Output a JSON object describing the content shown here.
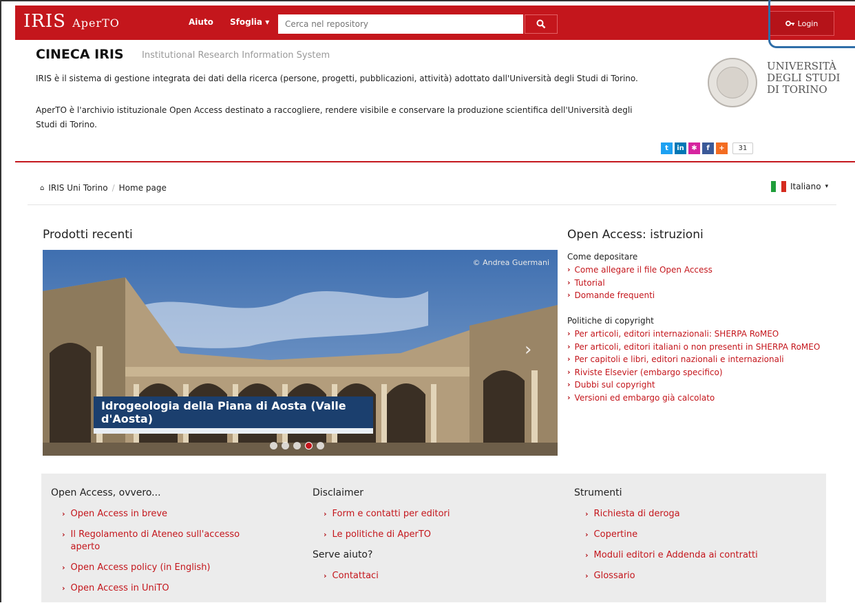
{
  "navbar": {
    "brand": "IRIS",
    "brand_sub": "AperTO",
    "links": [
      "Aiuto",
      "Sfoglia"
    ],
    "search_placeholder": "Cerca nel repository",
    "login_label": "Login",
    "accent": "#c4161c"
  },
  "header": {
    "title": "CINECA IRIS",
    "subtitle": "Institutional Research Information System",
    "desc1": "IRIS è il sistema di gestione integrata dei dati della ricerca (persone, progetti, pubblicazioni, attività) adottato dall'Università degli Studi di Torino.",
    "desc2": "AperTO è l'archivio istituzionale Open Access destinato a raccogliere, rendere visibile e conservare la produzione scientifica dell'Università degli Studi di Torino.",
    "university": [
      "UNIVERSITÀ",
      "DEGLI STUDI",
      "DI TORINO"
    ],
    "share_count": "31"
  },
  "breadcrumb": {
    "items": [
      "IRIS Uni Torino",
      "Home page"
    ],
    "language": "Italiano"
  },
  "recent": {
    "heading": "Prodotti recenti",
    "credit": "© Andrea Guermani",
    "caption": "Idrogeologia della Piana di Aosta (Valle d'Aosta)"
  },
  "oa": {
    "heading": "Open Access: istruzioni",
    "section1_title": "Come depositare",
    "section1_links": [
      "Come allegare il file Open Access",
      "Tutorial",
      "Domande frequenti"
    ],
    "section2_title": "Politiche di copyright",
    "section2_links": [
      "Per articoli, editori internazionali: SHERPA RoMEO",
      "Per articoli, editori italiani o non presenti in SHERPA RoMEO",
      "Per capitoli e libri, editori nazionali e internazionali",
      "Riviste Elsevier (embargo specifico)",
      "Dubbi sul copyright",
      "Versioni ed embargo già calcolato"
    ]
  },
  "footer": {
    "col1_title": "Open Access, ovvero...",
    "col1_links": [
      "Open Access in breve",
      "Il Regolamento di Ateneo sull'accesso aperto",
      "Open Access policy (in English)",
      "Open Access in UniTO"
    ],
    "col2_title": "Disclaimer",
    "col2_links": [
      "Form e contatti per editori",
      "Le politiche di AperTO"
    ],
    "col2b_title": "Serve aiuto?",
    "col2b_links": [
      "Contattaci"
    ],
    "col3_title": "Strumenti",
    "col3_links": [
      "Richiesta di deroga",
      "Copertine",
      "Moduli editori e Addenda ai contratti",
      "Glossario"
    ]
  }
}
